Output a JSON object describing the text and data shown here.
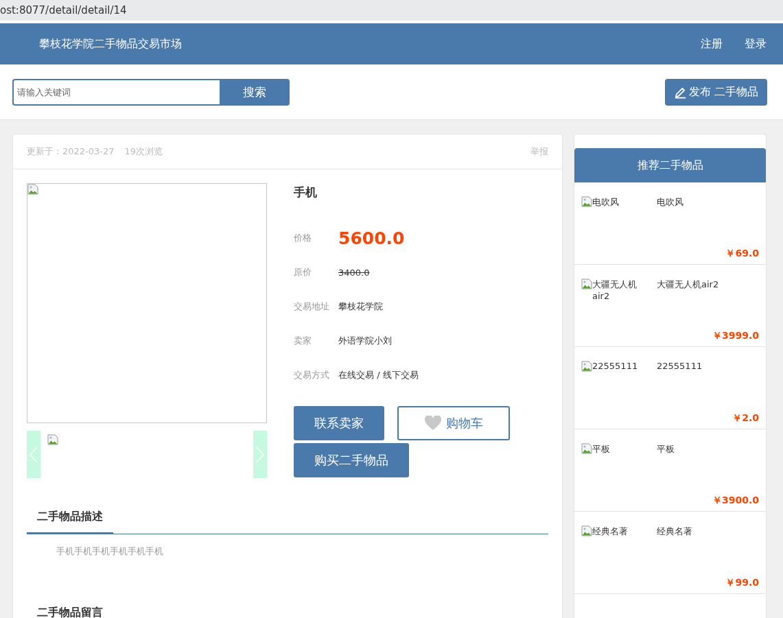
{
  "address_bar": {
    "url": "ost:8077/detail/detail/14"
  },
  "header": {
    "site_title": "攀枝花学院二手物品交易市场",
    "links": [
      "注册",
      "登录"
    ]
  },
  "search": {
    "placeholder": "请输入关键词",
    "button": "搜索"
  },
  "publish_button": {
    "label": "发布 二手物品"
  },
  "item": {
    "updated": "更新于：2022-03-27",
    "views": "19次浏览",
    "report": "举报",
    "title": "手机",
    "fields": [
      {
        "kind": "price",
        "label": "价格",
        "value": "5600.0"
      },
      {
        "kind": "original",
        "label": "原价",
        "value": "3400.0"
      },
      {
        "kind": "plain",
        "label": "交易地址",
        "value": "攀枝花学院"
      },
      {
        "kind": "plain",
        "label": "卖家",
        "value": "外语学院小刘"
      },
      {
        "kind": "plain",
        "label": "交易方式",
        "value": "在线交易 / 线下交易"
      }
    ],
    "buttons": [
      {
        "kind": "primary",
        "label": "联系卖家"
      },
      {
        "kind": "outline",
        "label": "购物车"
      },
      {
        "kind": "primary",
        "label": "购买二手物品"
      }
    ]
  },
  "sections": [
    {
      "kind": "tab",
      "title": "二手物品描述",
      "text": "手机手机手机手机手机手机"
    },
    {
      "kind": "heading",
      "title": "二手物品留言"
    }
  ],
  "recommend": {
    "title": "推荐二手物品",
    "items": [
      {
        "image_alt": "电吹风",
        "name": "电吹风",
        "price": "￥69.0"
      },
      {
        "image_alt": "大疆无人机air2",
        "name": "大疆无人机air2",
        "price": "￥3999.0"
      },
      {
        "image_alt": "22555111",
        "name": "22555111",
        "price": "￥2.0"
      },
      {
        "image_alt": "平板",
        "name": "平板",
        "price": "￥3900.0"
      },
      {
        "image_alt": "经典名著",
        "name": "经典名著",
        "price": "￥99.0"
      }
    ]
  }
}
